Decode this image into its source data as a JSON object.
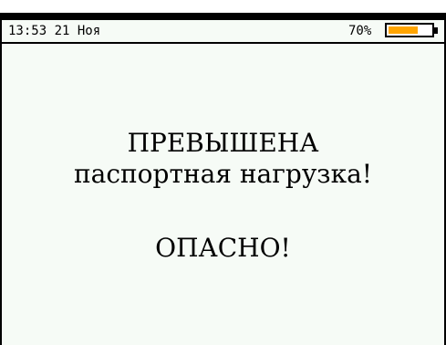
{
  "status_bar": {
    "time": "13:53",
    "date": "21 Ноя",
    "battery_percent_label": "70%",
    "battery_level": 0.7,
    "battery_color": "#ffa500"
  },
  "warning": {
    "line1": "ПРЕВЫШЕНА",
    "line2": "паспортная нагрузка!",
    "line3": "ОПАСНО!"
  }
}
